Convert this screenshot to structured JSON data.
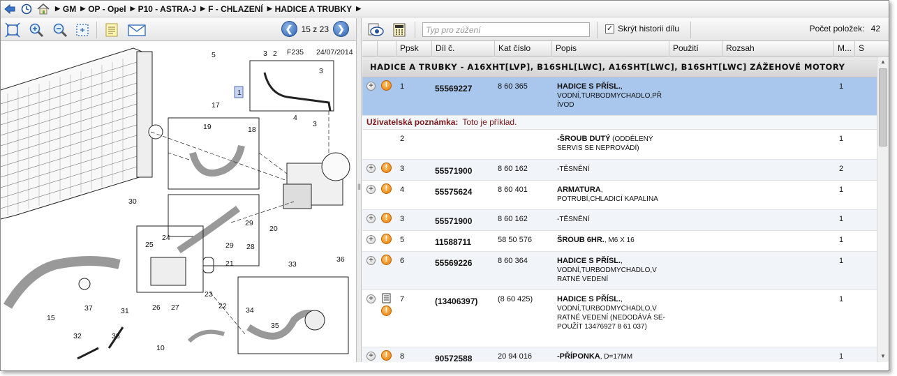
{
  "breadcrumb": {
    "items": [
      "GM",
      "OP - Opel",
      "P10 - ASTRA-J",
      "F - CHLAZENÍ",
      "HADICE A TRUBKY"
    ]
  },
  "diagram": {
    "pager": "15 z 23",
    "code": "F235",
    "date": "24/07/2014",
    "callouts": [
      "1",
      "2",
      "3",
      "3",
      "3",
      "4",
      "5",
      "15",
      "17",
      "18",
      "19",
      "20",
      "21",
      "22",
      "23",
      "24",
      "25",
      "26",
      "27",
      "28",
      "29",
      "29",
      "30",
      "31",
      "32",
      "33",
      "34",
      "35",
      "36",
      "37",
      "38",
      "10"
    ]
  },
  "toolbar": {
    "filter_placeholder": "Typ pro zúžení",
    "hide_history_label": "Skrýt historii dílu",
    "hide_history_checked": true,
    "count_label": "Počet položek:",
    "count_value": "42"
  },
  "table": {
    "columns": [
      "Ppsk",
      "Díl č.",
      "Kat číslo",
      "Popis",
      "Použití",
      "Rozsah",
      "M...",
      "S"
    ],
    "group_header": "HADICE A TRUBKY - A16XHT[LVP], B16SHL[LWC], A16SHT[LWC], B16SHT[LWC] ZÁŽEHOVÉ MOTORY",
    "note_label": "Uživatelská poznámka:",
    "note_text": "Toto je příklad.",
    "rows": [
      {
        "pos": "1",
        "part": "55569227",
        "kat": "8 60 365",
        "desc_bold": "HADICE S PŘÍSL.",
        "desc": ", VODNÍ,TURBODMYCHADLO,PŘ ÍVOD",
        "qty": "1"
      },
      {
        "pos": "2",
        "part": "",
        "kat": "",
        "desc_bold": "-ŠROUB DUTÝ",
        "desc": " (ODDĚLENÝ SERVIS SE NEPROVÁDÍ)",
        "qty": "1"
      },
      {
        "pos": "3",
        "part": "55571900",
        "kat": "8 60 162",
        "desc_bold": "",
        "desc": "-TĚSNĚNÍ",
        "qty": "2"
      },
      {
        "pos": "4",
        "part": "55575624",
        "kat": "8 60 401",
        "desc_bold": "ARMATURA",
        "desc": ", POTRUBÍ,CHLADICÍ KAPALINA",
        "qty": "1"
      },
      {
        "pos": "3",
        "part": "55571900",
        "kat": "8 60 162",
        "desc_bold": "",
        "desc": "-TĚSNĚNÍ",
        "qty": "1"
      },
      {
        "pos": "5",
        "part": "11588711",
        "kat": "58 50 576",
        "desc_bold": "ŠROUB 6HR.",
        "desc": ", M6 X 16",
        "qty": "1"
      },
      {
        "pos": "6",
        "part": "55569226",
        "kat": "8 60 364",
        "desc_bold": "HADICE S PŘÍSL.",
        "desc": ", VODNÍ,TURBODMYCHADLO,V RATNÉ VEDENÍ",
        "qty": "1"
      },
      {
        "pos": "7",
        "part": "(13406397)",
        "kat": "(8 60 425)",
        "desc_bold": "HADICE S PŘÍSL.",
        "desc": ", VODNÍ,TURBODMYCHADLO,V RATNÉ VEDENÍ  (NEDODÁVÁ SE-POUŽÍT 13476927  8 61 037)",
        "qty": "1"
      },
      {
        "pos": "8",
        "part": "90572588",
        "kat": "20 94 016",
        "desc_bold": "-PŘÍPONKA",
        "desc": ", D=17MM",
        "qty": "1"
      }
    ]
  },
  "icons": {
    "back": "back-arrow-icon",
    "history": "clock-icon",
    "home": "home-icon",
    "fit": "fit-to-window-icon",
    "zoom_in": "zoom-in-icon",
    "zoom_out": "zoom-out-icon",
    "select": "select-area-icon",
    "notes": "notes-icon",
    "mail": "mail-icon",
    "view": "eye-icon",
    "calc": "calculator-icon"
  },
  "colors": {
    "selected_row": "#a9c6ec",
    "warning": "#e87a00",
    "note_text": "#7a1a1a"
  }
}
